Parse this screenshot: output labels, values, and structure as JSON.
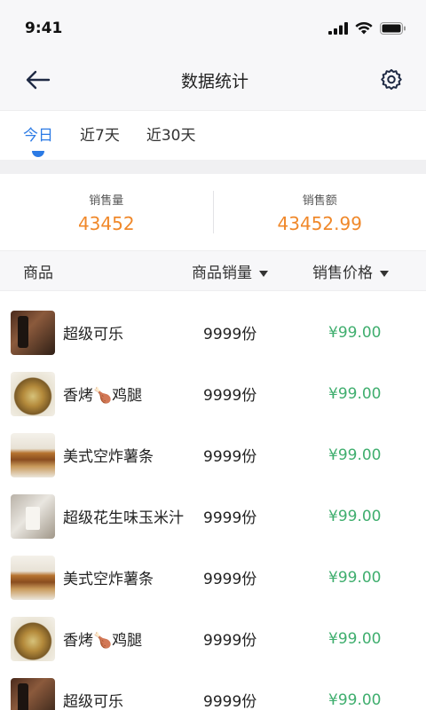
{
  "status_bar": {
    "time": "9:41"
  },
  "nav": {
    "title": "数据统计",
    "back_icon": "arrow-left-icon",
    "settings_icon": "gear-icon"
  },
  "tabs": [
    {
      "label": "今日",
      "active": true
    },
    {
      "label": "近7天",
      "active": false
    },
    {
      "label": "近30天",
      "active": false
    }
  ],
  "summary": {
    "sales_volume": {
      "label": "销售量",
      "value": "43452"
    },
    "sales_amount": {
      "label": "销售额",
      "value": "43452.99"
    }
  },
  "table": {
    "headers": {
      "name": "商品",
      "qty": "商品销量",
      "price": "销售价格"
    },
    "rows": [
      {
        "name": "超级可乐",
        "qty": "9999份",
        "price": "¥99.00",
        "image": "cola"
      },
      {
        "name": "香烤🍗鸡腿",
        "qty": "9999份",
        "price": "¥99.00",
        "image": "chicken"
      },
      {
        "name": "美式空炸薯条",
        "qty": "9999份",
        "price": "¥99.00",
        "image": "fries"
      },
      {
        "name": "超级花生味玉米汁",
        "qty": "9999份",
        "price": "¥99.00",
        "image": "corn"
      },
      {
        "name": "美式空炸薯条",
        "qty": "9999份",
        "price": "¥99.00",
        "image": "fries"
      },
      {
        "name": "香烤🍗鸡腿",
        "qty": "9999份",
        "price": "¥99.00",
        "image": "chicken"
      },
      {
        "name": "超级可乐",
        "qty": "9999份",
        "price": "¥99.00",
        "image": "cola"
      }
    ]
  },
  "colors": {
    "accent": "#2c7be5",
    "summary_value": "#f0882a",
    "price": "#3fae6e"
  }
}
